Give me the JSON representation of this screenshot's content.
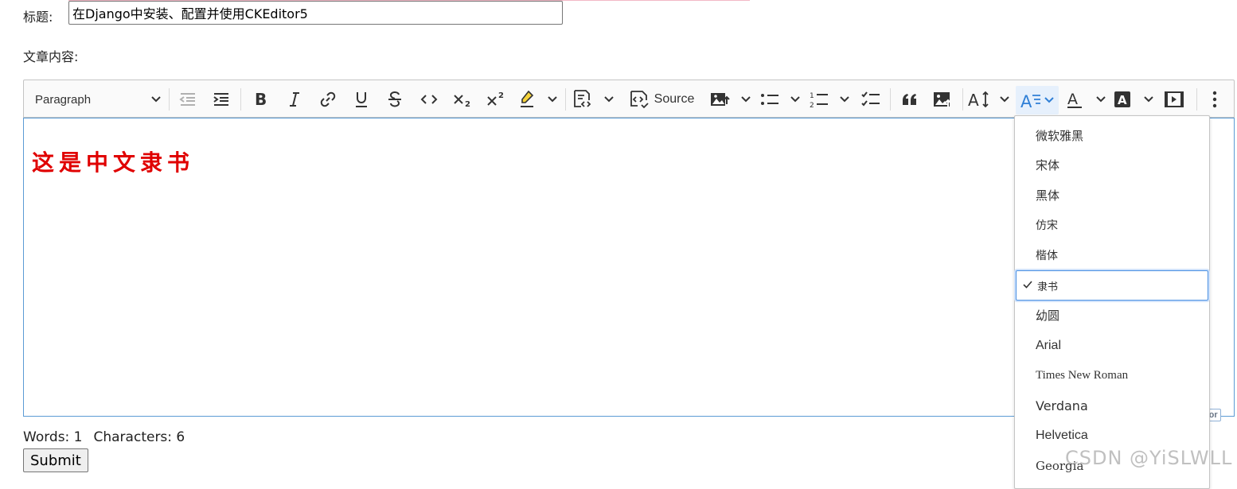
{
  "form": {
    "title_label": "标题:",
    "title_value": "在Django中安装、配置并使用CKEditor5",
    "content_label": "文章内容:",
    "words": "Words: 1",
    "characters": "Characters: 6",
    "submit_label": "Submit"
  },
  "toolbar": {
    "heading_value": "Paragraph",
    "source_label": "Source",
    "icons": [
      "outdent-icon",
      "indent-icon",
      "bold-icon",
      "italic-icon",
      "link-icon",
      "underline-icon",
      "strikethrough-icon",
      "code-icon",
      "subscript-icon",
      "superscript-icon",
      "highlight-icon",
      "chevron-down-icon",
      "code-block-icon",
      "source-icon",
      "insert-image-icon",
      "bulleted-list-icon",
      "numbered-list-icon",
      "todo-list-icon",
      "blockquote-icon",
      "image-upload-icon",
      "font-size-icon",
      "font-family-icon",
      "font-color-icon",
      "font-background-icon",
      "media-embed-icon",
      "more-icon"
    ]
  },
  "editor": {
    "content_text": "这是中文隶书",
    "powered_by": "tor",
    "content_color": "#e00000"
  },
  "font_family_dropdown": {
    "selected": "隶书",
    "items": [
      {
        "label": "微软雅黑",
        "family": "\"DejaVu Sans\", sans-serif",
        "size": 15
      },
      {
        "label": "宋体",
        "family": "\"DejaVu Sans\", sans-serif",
        "size": 15
      },
      {
        "label": "黑体",
        "family": "\"DejaVu Sans\", sans-serif",
        "size": 15
      },
      {
        "label": "仿宋",
        "family": "\"DejaVu Serif\", serif",
        "size": 14
      },
      {
        "label": "楷体",
        "family": "\"DejaVu Serif\", serif",
        "size": 14
      },
      {
        "label": "隶书",
        "family": "\"DejaVu Serif\", serif",
        "size": 13
      },
      {
        "label": "幼圆",
        "family": "\"DejaVu Sans\", sans-serif",
        "size": 15
      },
      {
        "label": "Arial",
        "family": "\"Liberation Sans\", sans-serif",
        "size": 16
      },
      {
        "label": "Times New Roman",
        "family": "\"Liberation Serif\", serif",
        "size": 15
      },
      {
        "label": "Verdana",
        "family": "\"DejaVu Sans\", sans-serif",
        "size": 16
      },
      {
        "label": "Helvetica",
        "family": "\"Liberation Sans\", sans-serif",
        "size": 16
      },
      {
        "label": "Georgia",
        "family": "\"DejaVu Serif\", serif",
        "size": 15
      }
    ]
  },
  "watermark": "CSDN @YiSLWLL",
  "colors": {
    "accent": "#4a90e2",
    "active_button_bg": "#e6f0fc"
  }
}
